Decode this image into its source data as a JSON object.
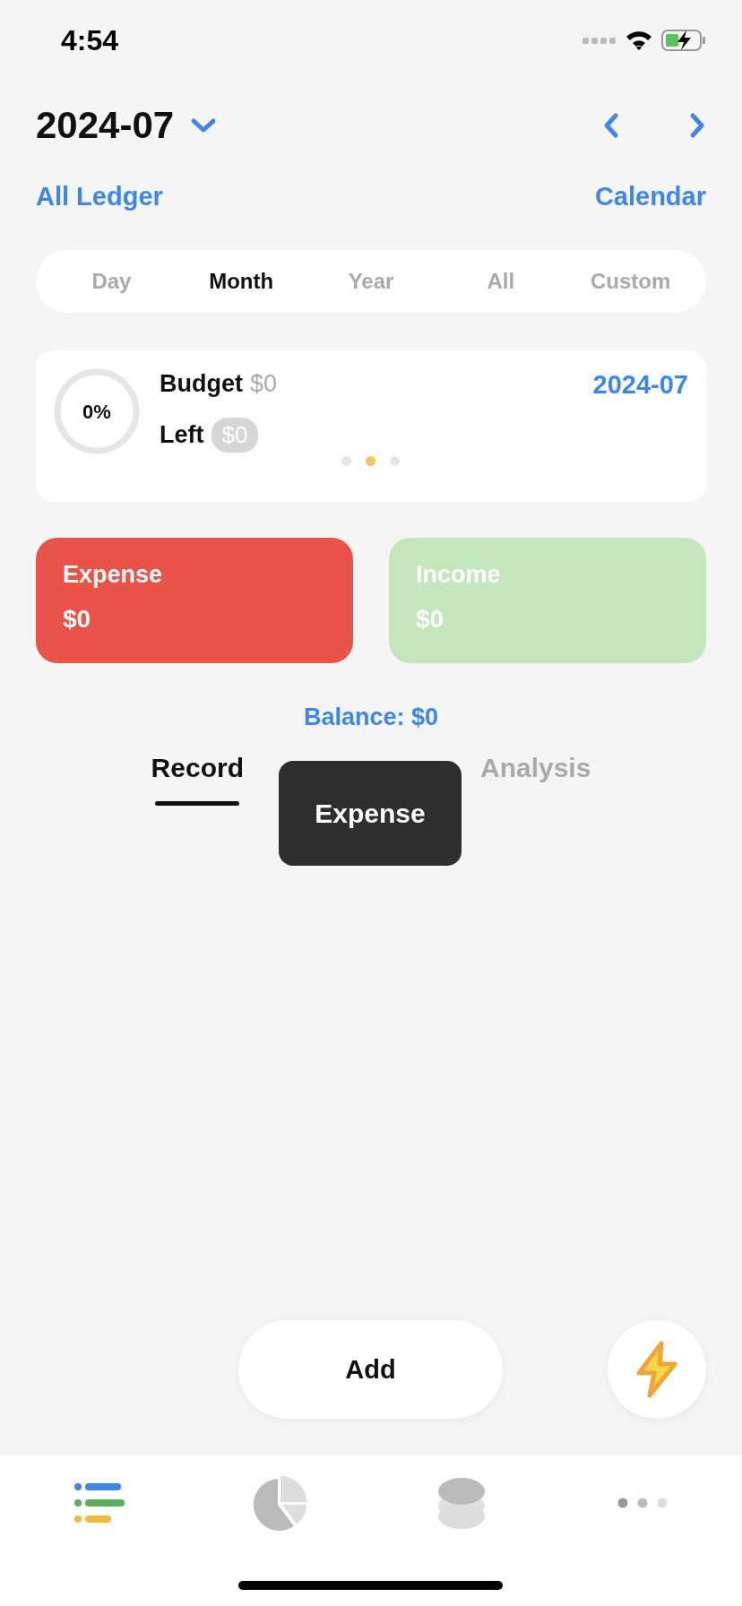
{
  "status_bar": {
    "time": "4:54"
  },
  "header": {
    "period": "2024-07"
  },
  "links": {
    "ledger": "All Ledger",
    "calendar": "Calendar"
  },
  "periods": [
    {
      "label": "Day",
      "selected": false
    },
    {
      "label": "Month",
      "selected": true
    },
    {
      "label": "Year",
      "selected": false
    },
    {
      "label": "All",
      "selected": false
    },
    {
      "label": "Custom",
      "selected": false
    }
  ],
  "budget_card": {
    "progress": "0%",
    "level": 0,
    "budget_label": "Budget",
    "budget_amount": "$0",
    "left_label": "Left",
    "left_amount": "$0",
    "period": "2024-07",
    "pages": [
      {
        "selected": false
      },
      {
        "selected": true
      },
      {
        "selected": false
      }
    ]
  },
  "summary": [
    {
      "kind": "expense",
      "label": "Expense",
      "amount": "$0"
    },
    {
      "kind": "income",
      "label": "Income",
      "amount": "$0"
    }
  ],
  "balance": "Balance: $0",
  "view_tabs": [
    {
      "label": "Record",
      "selected": true
    },
    {
      "label": "Analysis",
      "selected": false
    }
  ],
  "tooltip": "Expense",
  "add_button": "Add",
  "tab_bar": [
    {
      "kind": "list",
      "selected": true
    },
    {
      "kind": "pie",
      "selected": false
    },
    {
      "kind": "coins",
      "selected": false
    },
    {
      "kind": "more",
      "selected": false
    }
  ]
}
